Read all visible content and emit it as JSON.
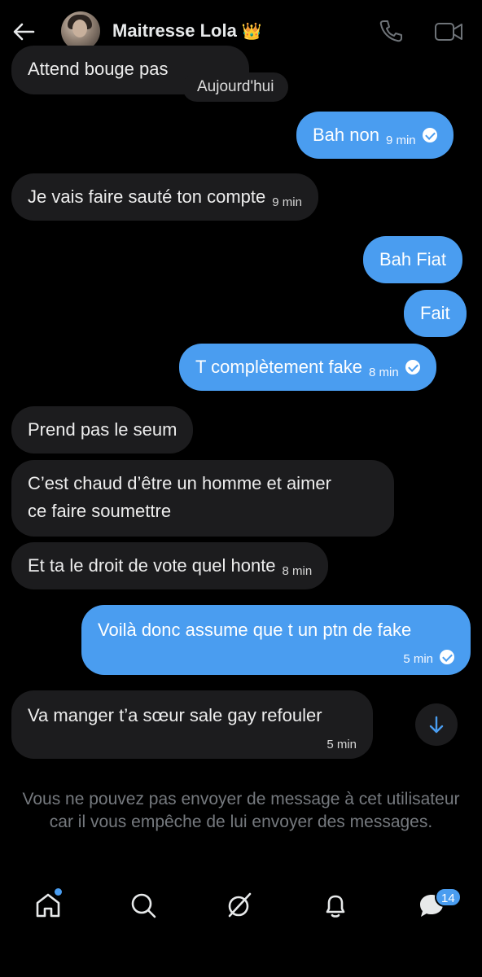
{
  "header": {
    "contact_name": "Maitresse Lola",
    "crown": "👑",
    "icons": [
      "back-arrow-icon",
      "phone-icon",
      "video-icon"
    ]
  },
  "date_label": "Aujourd'hui",
  "messages": [
    {
      "side": "received",
      "text": "Attend bouge pas",
      "time": ""
    },
    {
      "side": "sent",
      "text": "Bah non",
      "time": "9 min",
      "read": true
    },
    {
      "side": "received",
      "text": "Je vais faire sauté ton compte",
      "time": "9 min"
    },
    {
      "side": "sent",
      "text": "Bah Fiat",
      "time": ""
    },
    {
      "side": "sent",
      "text": "Fait",
      "time": ""
    },
    {
      "side": "sent",
      "text": "T complètement fake",
      "time": "8 min",
      "read": true
    },
    {
      "side": "received",
      "text": "Prend pas le seum",
      "time": ""
    },
    {
      "side": "received",
      "text_line1": "C’est chaud d’être un homme et aimer",
      "text_line2": "ce faire soumettre",
      "time": ""
    },
    {
      "side": "received",
      "text": "Et ta le droit de vote quel honte",
      "time": "8 min"
    },
    {
      "side": "sent",
      "text": "Voilà donc assume que t un ptn de fake",
      "time": "5 min",
      "read": true
    },
    {
      "side": "received",
      "text": "Va manger t’a sœur sale gay refouler",
      "time": "5 min"
    }
  ],
  "blocked_notice": "Vous ne pouvez pas envoyer de message à cet utilisateur car il vous empêche de lui envoyer des messages.",
  "nav": {
    "items": [
      "home-icon",
      "search-icon",
      "grok-icon",
      "notifications-icon",
      "messages-icon"
    ],
    "messages_badge": "14"
  },
  "colors": {
    "accent": "#4a9df0",
    "received_bubble": "#1c1c1e",
    "background": "#000000"
  }
}
